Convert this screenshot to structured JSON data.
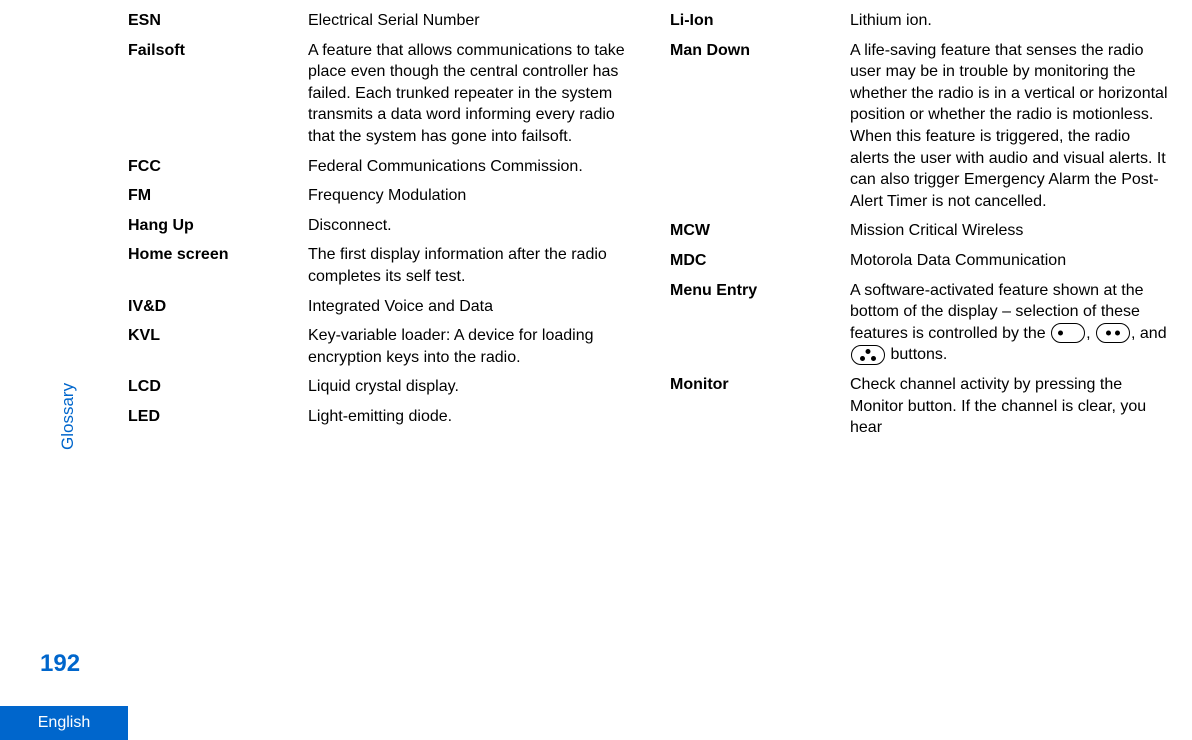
{
  "sidebar": {
    "section_label": "Glossary",
    "page_number": "192"
  },
  "footer": {
    "language": "English"
  },
  "left_entries": [
    {
      "term": "ESN",
      "def": "Electrical Serial Number"
    },
    {
      "term": "Failsoft",
      "def": "A feature that allows communications to take place even though the central controller has failed. Each trunked repeater in the system transmits a data word informing every radio that the system has gone into failsoft."
    },
    {
      "term": "FCC",
      "def": "Federal Communications Commission."
    },
    {
      "term": "FM",
      "def": "Frequency Modulation"
    },
    {
      "term": "Hang Up",
      "def": "Disconnect."
    },
    {
      "term": "Home screen",
      "def": "The first display information after the radio completes its self test."
    },
    {
      "term": "IV&D",
      "def": "Integrated Voice and Data"
    },
    {
      "term": "KVL",
      "def": "Key-variable loader: A device for loading encryption keys into the radio."
    },
    {
      "term": "LCD",
      "def": "Liquid crystal display."
    },
    {
      "term": "LED",
      "def": "Light-emitting diode."
    }
  ],
  "right_entries": [
    {
      "term": "Li-Ion",
      "def": "Lithium ion."
    },
    {
      "term": "Man Down",
      "def": "A life-saving feature that senses the radio user may be in trouble by monitoring the whether the radio is in a vertical or horizontal position or whether the radio is motionless. When this feature is triggered, the radio alerts the user with audio and visual alerts. It can also trigger Emergency Alarm the Post-Alert Timer is not cancelled."
    },
    {
      "term": "MCW",
      "def": "Mission Critical Wireless"
    },
    {
      "term": "MDC",
      "def": "Motorola Data Communication"
    },
    {
      "term": "Menu Entry",
      "def_prefix": "A software-activated feature shown at the bottom of the display – selection of these features is controlled by the ",
      "def_mid1": ", ",
      "def_mid2": ", and ",
      "def_suffix": " buttons."
    },
    {
      "term": "Monitor",
      "def": "Check channel activity by pressing the Monitor button. If the channel is clear, you hear"
    }
  ]
}
